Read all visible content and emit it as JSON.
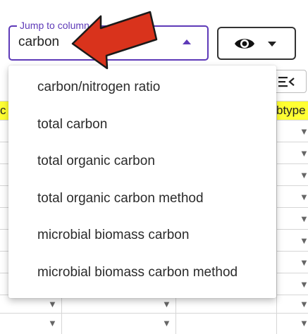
{
  "jump": {
    "label": "Jump to column",
    "value": "carbon"
  },
  "icons": {
    "visibility": "eye-icon",
    "visibility_caret": "caret-down-icon",
    "collapse": "collapse-columns-icon",
    "annotation": "red-arrow-annotation"
  },
  "colors": {
    "accent": "#5e3ab8",
    "header_highlight": "#ffff33",
    "annotation_arrow": "#d9331c"
  },
  "table": {
    "header_left_fragment": "c",
    "header_right_fragment": "btype"
  },
  "menu": {
    "items": [
      "carbon/nitrogen ratio",
      "total carbon",
      "total organic carbon",
      "total organic carbon method",
      "microbial biomass carbon",
      "microbial biomass carbon method"
    ]
  }
}
